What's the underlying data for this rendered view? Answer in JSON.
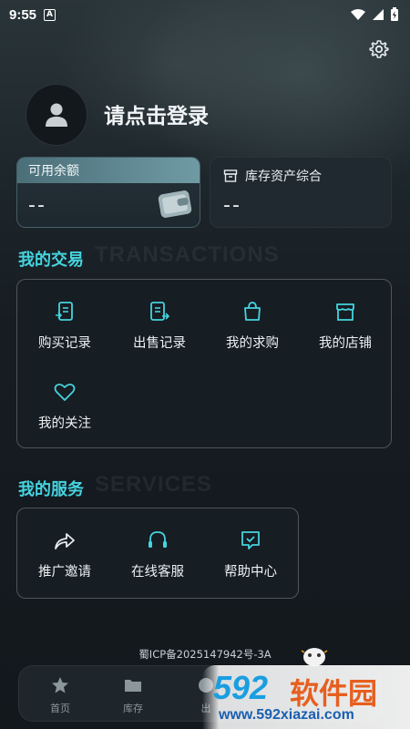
{
  "status_bar": {
    "time": "9:55",
    "a_badge": "A"
  },
  "profile": {
    "login_prompt": "请点击登录"
  },
  "balance_card": {
    "title": "可用余额",
    "value": "--"
  },
  "assets_card": {
    "title": "库存资产综合",
    "value": "--"
  },
  "transactions": {
    "title": "我的交易",
    "watermark": "TRANSACTIONS",
    "items": [
      {
        "label": "购买记录",
        "icon": "buy-record-icon"
      },
      {
        "label": "出售记录",
        "icon": "sell-record-icon"
      },
      {
        "label": "我的求购",
        "icon": "shopping-bag-icon"
      },
      {
        "label": "我的店铺",
        "icon": "store-icon"
      },
      {
        "label": "我的关注",
        "icon": "heart-icon"
      }
    ]
  },
  "services": {
    "title": "我的服务",
    "watermark": "SERVICES",
    "items": [
      {
        "label": "推广邀请",
        "icon": "share-icon"
      },
      {
        "label": "在线客服",
        "icon": "headset-icon"
      },
      {
        "label": "帮助中心",
        "icon": "help-chat-icon"
      }
    ]
  },
  "footer": {
    "icp": "蜀ICP备2025147942号-3A"
  },
  "tabbar": {
    "items": [
      {
        "label": "首页",
        "icon": "star-icon"
      },
      {
        "label": "库存",
        "icon": "folder-icon"
      },
      {
        "label": "出",
        "icon": "sell-icon"
      }
    ]
  },
  "watermark_logo": {
    "number": "592",
    "name": "软件园",
    "url": "www.592xiazai.com"
  },
  "colors": {
    "accent": "#45d4df",
    "background": "#141a20",
    "card": "#161d23"
  }
}
